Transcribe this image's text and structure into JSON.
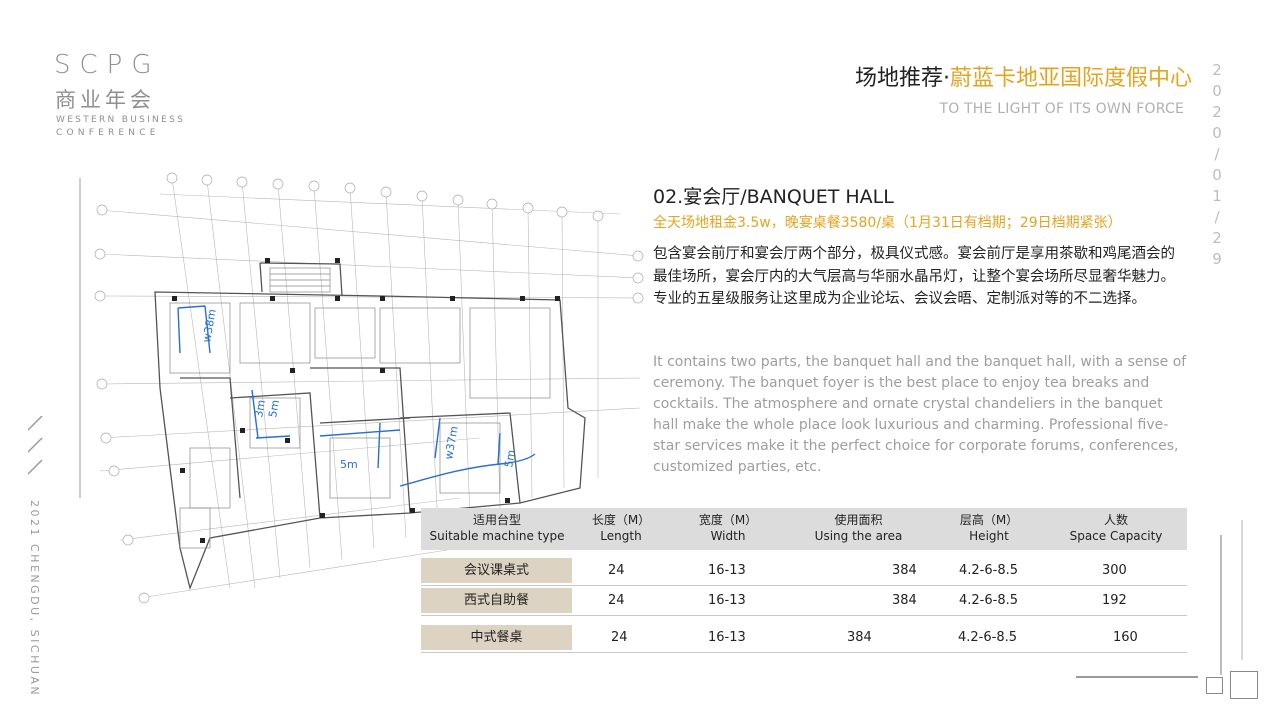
{
  "logo": {
    "scpg": "SCPG",
    "cn": "商业年会",
    "en_line1": "WESTERN BUSINESS",
    "en_line2": "CONFERENCE"
  },
  "header": {
    "title_prefix": "场地推荐·",
    "title_venue": "蔚蓝卡地亚国际度假中心",
    "subtitle": "TO THE LIGHT OF ITS OWN FORCE",
    "date_chars": [
      "2",
      "0",
      "2",
      "0",
      "/",
      "0",
      "1",
      "/",
      "2",
      "9"
    ]
  },
  "side": {
    "location": "2021 CHENGDU, SICHUAN"
  },
  "hall": {
    "title": "02.宴会厅/BANQUET HALL",
    "price": "全天场地租金3.5w，晚宴桌餐3580/桌（1月31日有档期；29日档期紧张）",
    "desc_cn": "包含宴会前厅和宴会厅两个部分，极具仪式感。宴会前厅是享用茶歇和鸡尾酒会的最佳场所，宴会厅内的大气层高与华丽水晶吊灯，让整个宴会场所尽显奢华魅力。专业的五星级服务让这里成为企业论坛、会议会晤、定制派对等的不二选择。",
    "desc_en": "It contains two parts, the banquet hall and the banquet hall, with a sense of ceremony. The banquet foyer is the best place to enjoy tea breaks and cocktails. The atmosphere and ornate crystal chandeliers in the banquet hall make the whole place look luxurious and charming. Professional five-star services make it the perfect choice for corporate forums, conferences, customized parties, etc."
  },
  "plan": {
    "annotations": [
      "w38m",
      "3m",
      "5m",
      "5m",
      "w37m",
      "5m"
    ]
  },
  "table": {
    "headers": [
      {
        "cn": "适用台型",
        "en": "Suitable machine type"
      },
      {
        "cn": "长度（M）",
        "en": "Length"
      },
      {
        "cn": "宽度（M）",
        "en": "Width"
      },
      {
        "cn": "使用面积",
        "en": "Using the area"
      },
      {
        "cn": "层高（M）",
        "en": "Height"
      },
      {
        "cn": "人数",
        "en": "Space Capacity"
      }
    ],
    "rows": [
      {
        "type": "会议课桌式",
        "length": "24",
        "width": "16-13",
        "area": "384",
        "height": "4.2-6-8.5",
        "capacity": "300"
      },
      {
        "type": "西式自助餐",
        "length": "24",
        "width": "16-13",
        "area": "384",
        "height": "4.2-6-8.5",
        "capacity": "192"
      },
      {
        "type": "中式餐桌",
        "length": "24",
        "width": "16-13",
        "area": "384",
        "height": "4.2-6-8.5",
        "capacity": "160"
      }
    ]
  },
  "colors": {
    "accent": "#e3a420",
    "row_label_bg": "#ddd3c2",
    "header_bg": "#dcdcdc",
    "annotation_blue": "#2a6fd1"
  }
}
